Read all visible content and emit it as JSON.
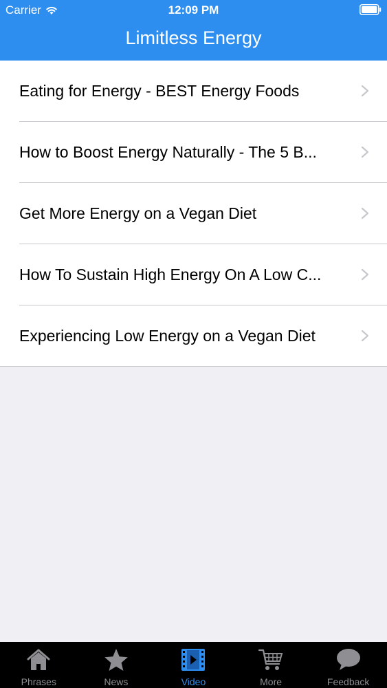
{
  "status_bar": {
    "carrier": "Carrier",
    "time": "12:09 PM"
  },
  "header": {
    "title": "Limitless Energy"
  },
  "list": {
    "items": [
      {
        "label": "Eating for Energy - BEST Energy Foods"
      },
      {
        "label": "How to Boost Energy Naturally - The 5 B..."
      },
      {
        "label": "Get More Energy on a Vegan Diet"
      },
      {
        "label": "How To Sustain High Energy On A Low C..."
      },
      {
        "label": "Experiencing Low Energy on a Vegan Diet"
      }
    ]
  },
  "tab_bar": {
    "active_index": 2,
    "tabs": [
      {
        "label": "Phrases",
        "icon": "house-icon"
      },
      {
        "label": "News",
        "icon": "star-icon"
      },
      {
        "label": "Video",
        "icon": "film-icon"
      },
      {
        "label": "More",
        "icon": "cart-icon"
      },
      {
        "label": "Feedback",
        "icon": "speech-bubble-icon"
      }
    ]
  },
  "colors": {
    "accent": "#2d8ef0",
    "background": "#efeff4",
    "tab_bar": "#000000",
    "tab_inactive": "#8e8e93"
  }
}
